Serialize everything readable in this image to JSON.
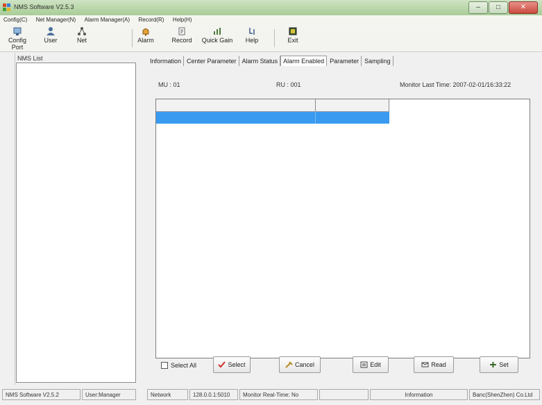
{
  "window": {
    "title": "NMS Software V2.5.3",
    "minimize_glyph": "–",
    "maximize_glyph": "□",
    "close_glyph": "✕"
  },
  "menu": [
    "Config(C)",
    "Net Manager(N)",
    "Alarm Manager(A)",
    "Record(R)",
    "Help(H)"
  ],
  "toolbar": {
    "config_port": "Config Port",
    "user": "User",
    "net": "Net",
    "alarm": "Alarm",
    "record": "Record",
    "quick_gain": "Quick Gain",
    "help": "Help",
    "exit": "Exit"
  },
  "left_panel": {
    "label": "NMS List"
  },
  "tabs": [
    "Information",
    "Center Parameter",
    "Alarm Status",
    "Alarm Enabled",
    "Parameter",
    "Sampling"
  ],
  "active_tab": "Alarm Enabled",
  "info": {
    "mu": "MU : 01",
    "ru": "RU : 001",
    "monitor_time": "Monitor Last Time: 2007-02-01/16:33:22"
  },
  "buttons": {
    "select_all": "Select All",
    "select": "Select",
    "cancel": "Cancel",
    "edit": "Edit",
    "read": "Read",
    "set": "Set"
  },
  "status": {
    "software": "NMS Software V2.5.2",
    "user": "User:Manager",
    "network": "Network",
    "ip": "128.0.0.1:5010",
    "realtime": "Monitor Real-Time: No",
    "blank": "",
    "information": "Information",
    "company": "Banc(ShenZhen) Co.Ltd"
  },
  "colors": {
    "selection": "#3a9af0",
    "titlebar": "#b7d6a7",
    "close": "#c94b3f"
  }
}
